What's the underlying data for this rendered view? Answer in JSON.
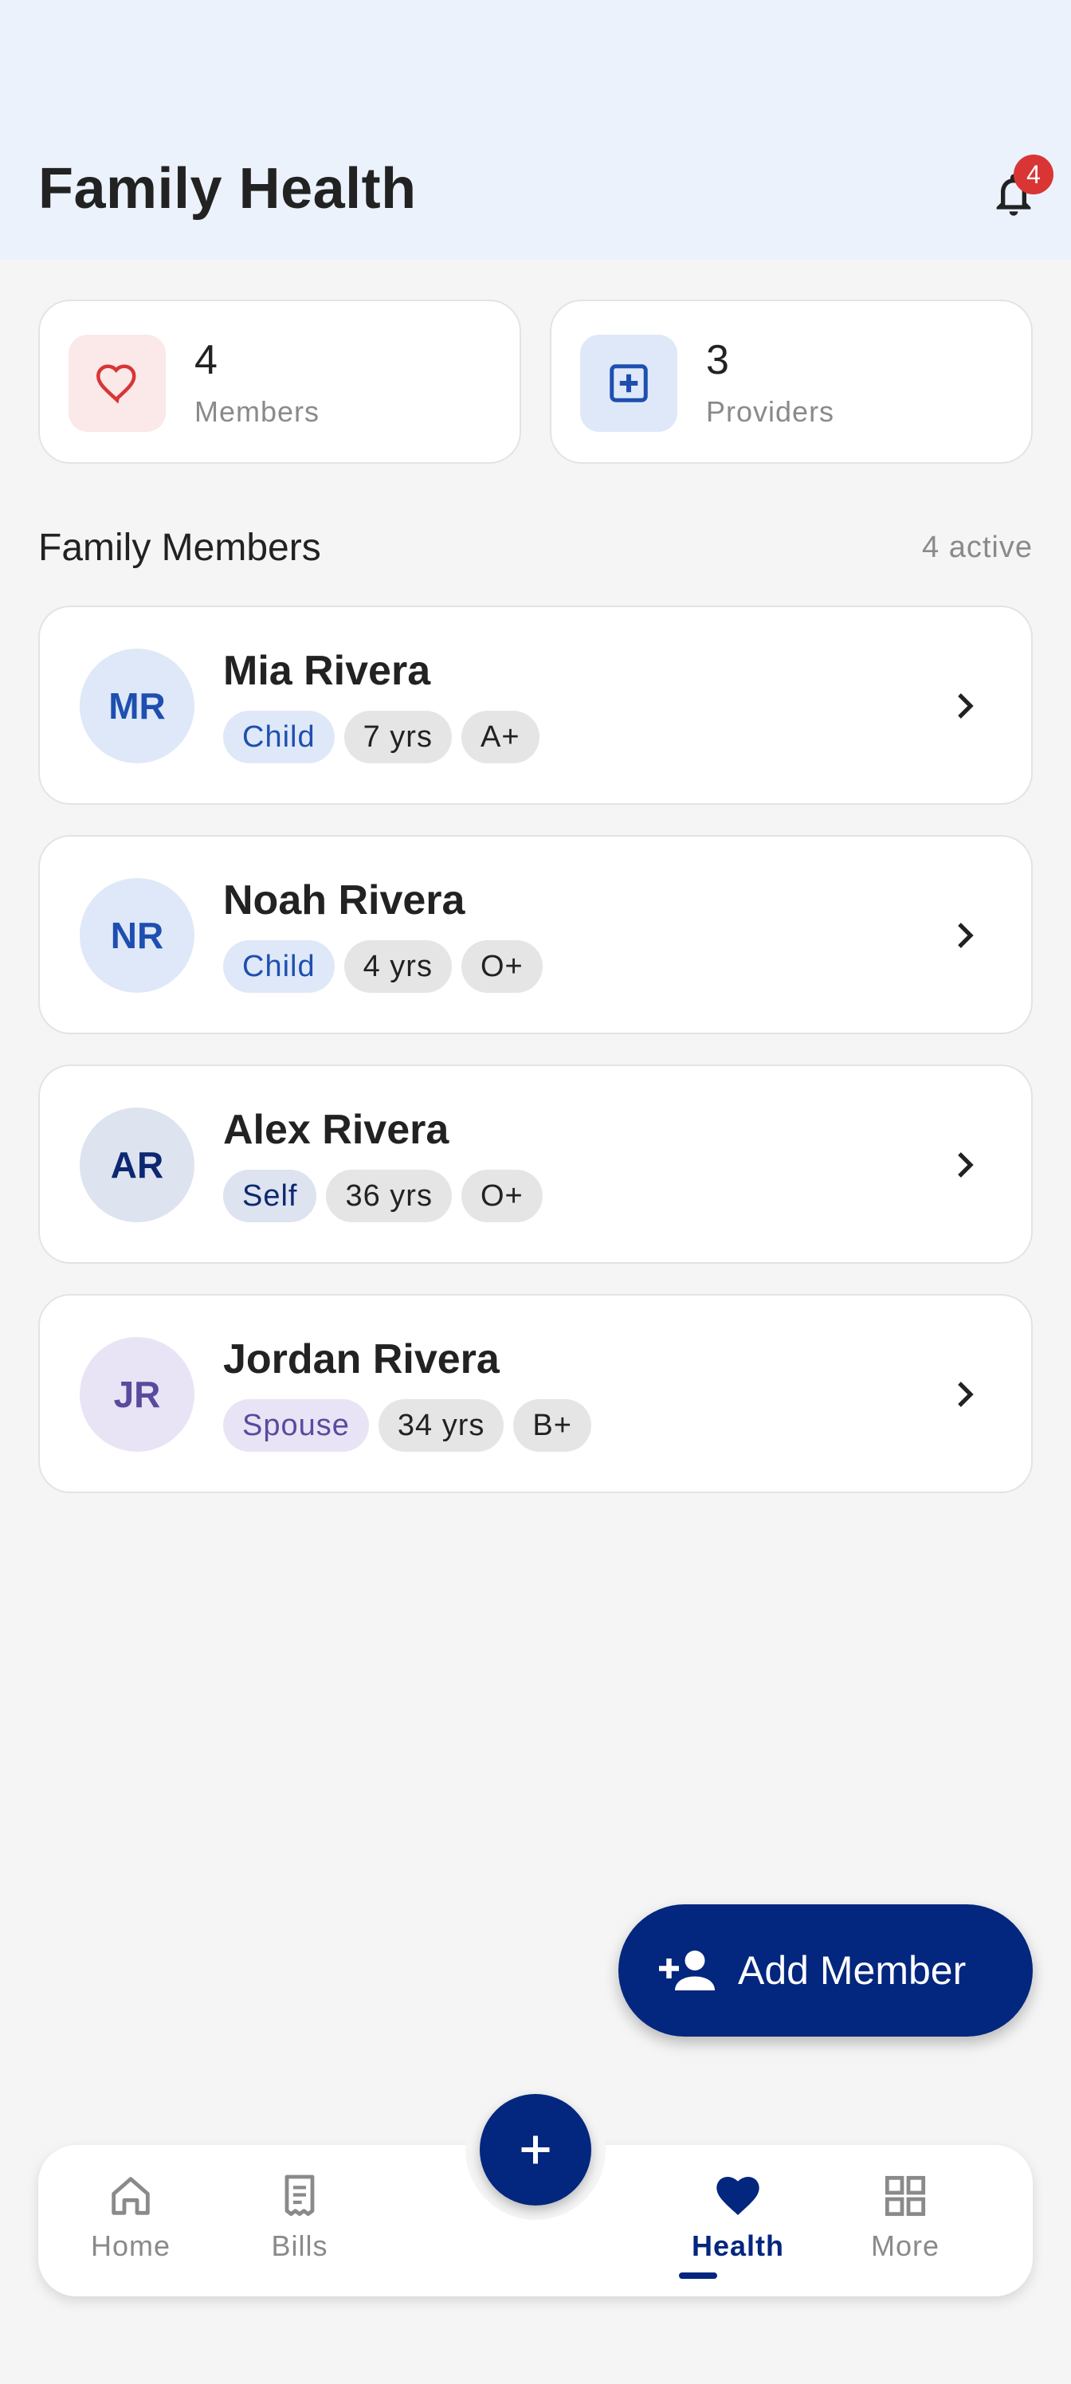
{
  "header": {
    "title": "Family Health",
    "notification_count": "4"
  },
  "stats": [
    {
      "value": "4",
      "label": "Members",
      "icon": "heart-icon"
    },
    {
      "value": "3",
      "label": "Providers",
      "icon": "medical-plus-icon"
    }
  ],
  "section": {
    "title": "Family Members",
    "meta": "4 active"
  },
  "members": [
    {
      "initials": "MR",
      "name": "Mia Rivera",
      "role": "Child",
      "age": "7 yrs",
      "blood": "A+"
    },
    {
      "initials": "NR",
      "name": "Noah Rivera",
      "role": "Child",
      "age": "4 yrs",
      "blood": "O+"
    },
    {
      "initials": "AR",
      "name": "Alex Rivera",
      "role": "Self",
      "age": "36 yrs",
      "blood": "O+"
    },
    {
      "initials": "JR",
      "name": "Jordan Rivera",
      "role": "Spouse",
      "age": "34 yrs",
      "blood": "B+"
    }
  ],
  "fab": {
    "label": "Add Member",
    "icon": "person-add-icon"
  },
  "nav": {
    "items": [
      {
        "label": "Home",
        "icon": "home-icon"
      },
      {
        "label": "Bills",
        "icon": "receipt-icon"
      },
      {
        "label": "Health",
        "icon": "heart-icon",
        "active": true
      },
      {
        "label": "More",
        "icon": "grid-icon"
      }
    ],
    "center_icon": "plus-icon"
  },
  "colors": {
    "primary": "#03267e",
    "header_bg": "#ebf2fb",
    "badge": "#d93535",
    "child_chip_bg": "#dfe8f8",
    "child_chip_text": "#1e4fb0",
    "self_chip_bg": "#dde3ef",
    "self_chip_text": "#0d2870",
    "spouse_chip_bg": "#e9e4f5",
    "spouse_chip_text": "#5a4a9e"
  }
}
